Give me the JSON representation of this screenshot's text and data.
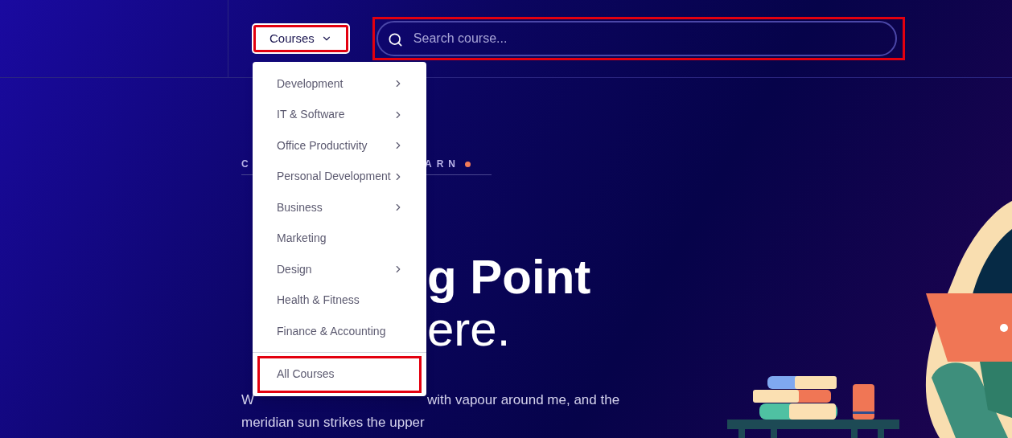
{
  "nav": {
    "courses_button": {
      "label": "Courses",
      "highlighted": true
    },
    "search": {
      "placeholder": "Search course...",
      "highlighted": true
    }
  },
  "menu": {
    "items": [
      {
        "label": "Development",
        "has_submenu": true
      },
      {
        "label": "IT & Software",
        "has_submenu": true
      },
      {
        "label": "Office Productivity",
        "has_submenu": true
      },
      {
        "label": "Personal Development",
        "has_submenu": true
      },
      {
        "label": "Business",
        "has_submenu": true
      },
      {
        "label": "Marketing",
        "has_submenu": false
      },
      {
        "label": "Design",
        "has_submenu": true
      },
      {
        "label": "Health & Fitness",
        "has_submenu": false
      },
      {
        "label": "Finance & Accounting",
        "has_submenu": false
      }
    ],
    "footer_item": {
      "label": "All Courses",
      "highlighted": true
    }
  },
  "hero": {
    "eyebrow": {
      "before": "C",
      "after": "ARN"
    },
    "headline": [
      {
        "kind": "bold",
        "after": "g Point"
      },
      {
        "kind": "large",
        "after": "ere."
      }
    ],
    "paragraph": [
      {
        "before": "W",
        "after": "with vapour around me, and the"
      },
      {
        "before": "meridian sun strikes the upper"
      }
    ]
  }
}
